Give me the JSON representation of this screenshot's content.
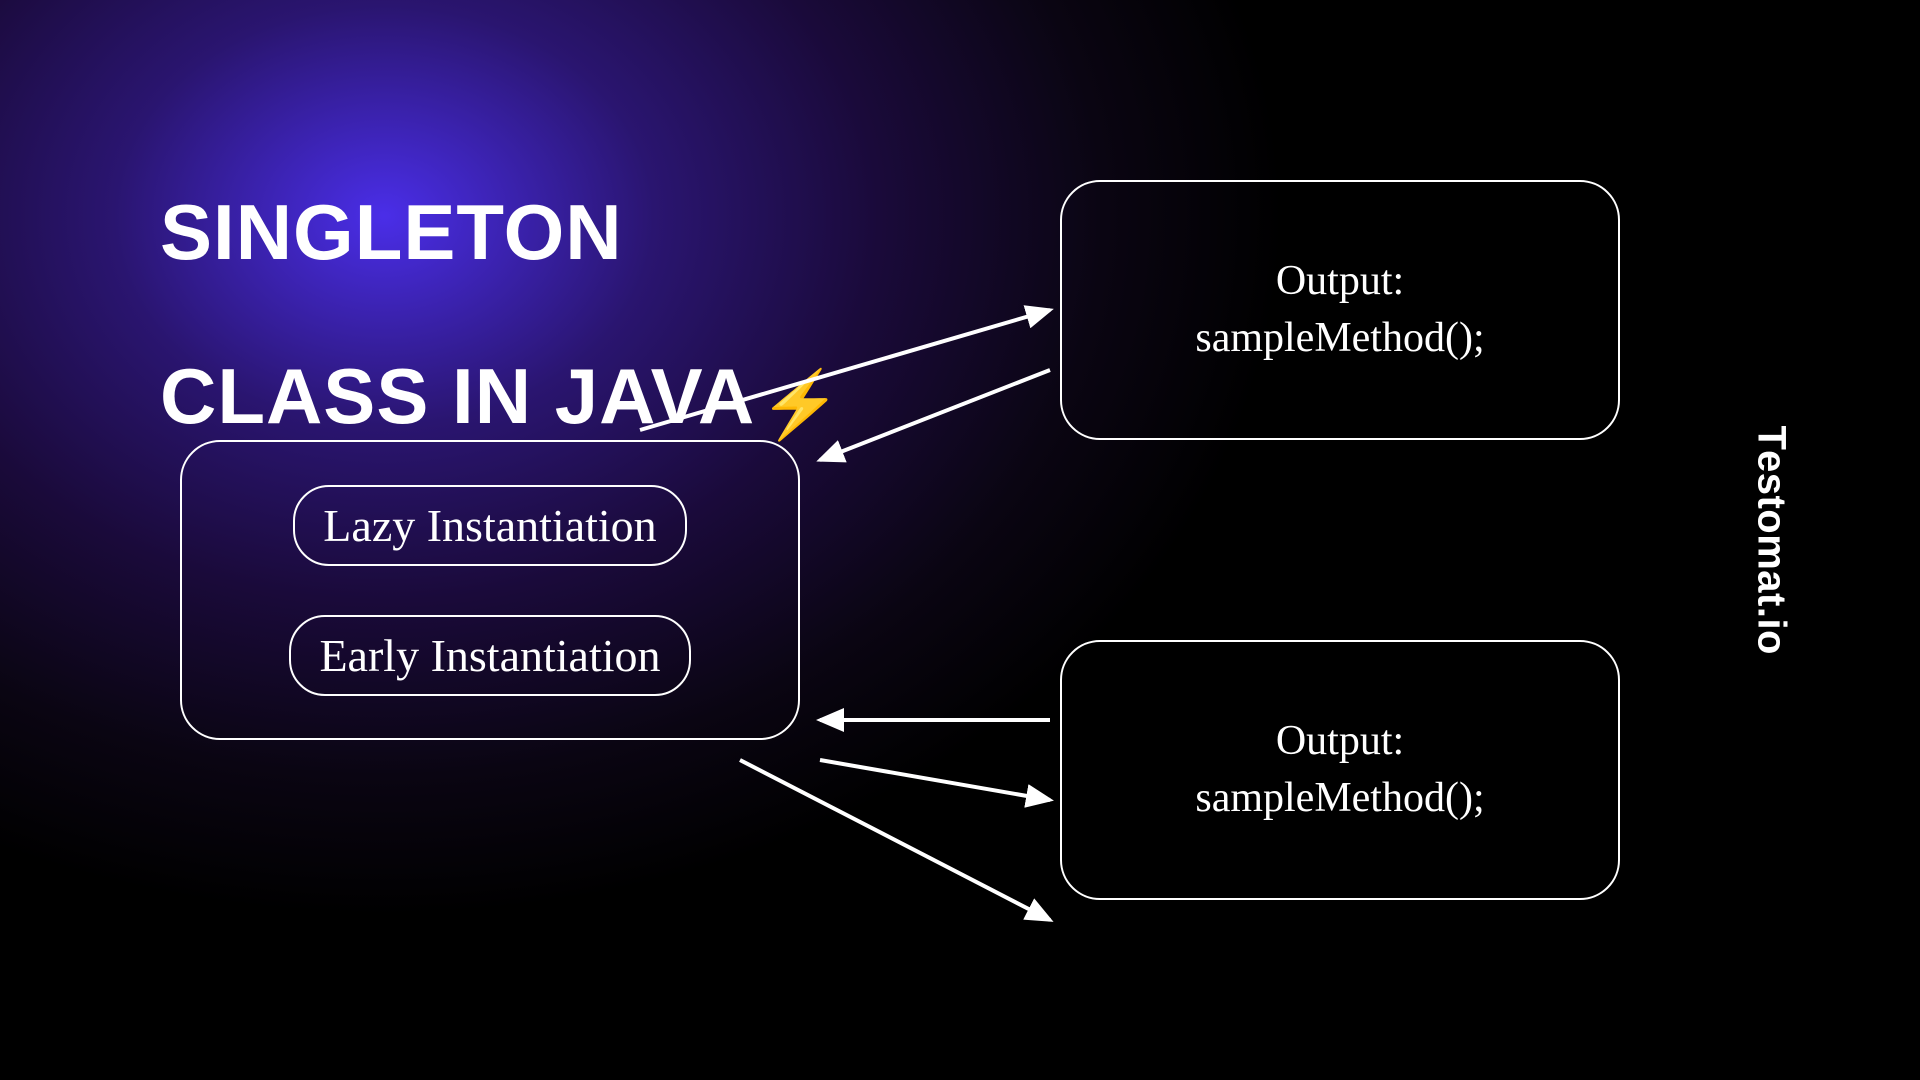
{
  "title_line1": "SINGLETON",
  "title_line2": "CLASS IN JAVA",
  "bolt": "⚡",
  "left_box": {
    "item1": "Lazy Instantiation",
    "item2": "Early Instantiation"
  },
  "output_top": {
    "line1": "Output:",
    "line2": "sampleMethod();"
  },
  "output_bottom": {
    "line1": "Output:",
    "line2": "sampleMethod();"
  },
  "brand": "estomat.io",
  "brand_prefix": "T"
}
